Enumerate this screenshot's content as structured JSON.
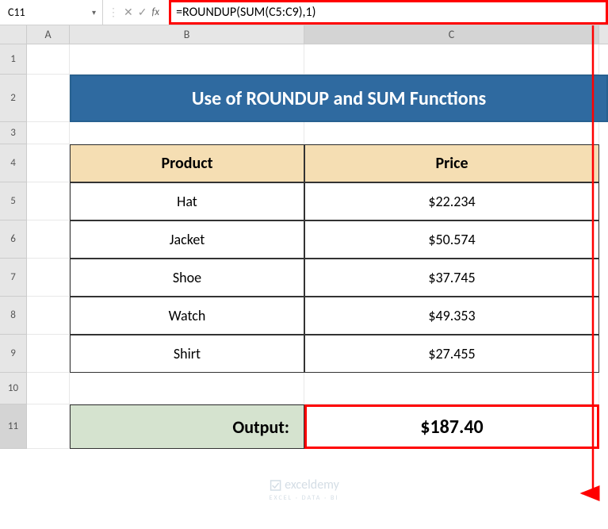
{
  "name_box": "C11",
  "fx_label": "fx",
  "formula": "=ROUNDUP(SUM(C5:C9),1)",
  "columns": {
    "a": "A",
    "b": "B",
    "c": "C"
  },
  "rows": [
    "1",
    "2",
    "3",
    "4",
    "5",
    "6",
    "7",
    "8",
    "9",
    "10",
    "11"
  ],
  "title": "Use of ROUNDUP and SUM Functions",
  "headers": {
    "product": "Product",
    "price": "Price"
  },
  "products": [
    {
      "name": "Hat",
      "price": "$22.234"
    },
    {
      "name": "Jacket",
      "price": "$50.574"
    },
    {
      "name": "Shoe",
      "price": "$37.745"
    },
    {
      "name": "Watch",
      "price": "$49.353"
    },
    {
      "name": "Shirt",
      "price": "$27.455"
    }
  ],
  "output_label": "Output:",
  "output_value": "$187.40",
  "watermark": "exceldemy",
  "watermark_sub": "EXCEL · DATA · BI",
  "chart_data": {
    "type": "table",
    "title": "Use of ROUNDUP and SUM Functions",
    "columns": [
      "Product",
      "Price"
    ],
    "rows": [
      [
        "Hat",
        22.234
      ],
      [
        "Jacket",
        50.574
      ],
      [
        "Shoe",
        37.745
      ],
      [
        "Watch",
        49.353
      ],
      [
        "Shirt",
        27.455
      ]
    ],
    "formula": "=ROUNDUP(SUM(C5:C9),1)",
    "output": 187.4
  }
}
